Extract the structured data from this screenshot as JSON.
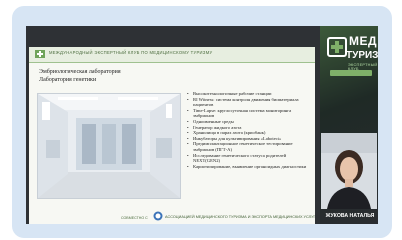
{
  "slide": {
    "header_title": "МЕЖДУНАРОДНЫЙ ЭКСПЕРТНЫЙ КЛУБ ПО МЕДИЦИНСКОМУ ТУРИЗМУ",
    "heading_line1": "Эмбриологическая лаборатория",
    "heading_line2": "Лаборатория генетики",
    "bullets": [
      "Высокотехнологичные рабочие станции",
      "RI Witness: система контроля движения биоматериала пациентов",
      "Time-Lapse: круглосуточная система мониторинга эмбрионов",
      "Одноименные среды",
      "Генератор жидкого азота",
      "Хранилища в парах азота (криобанк)",
      "Инкубаторы для культивирования «Labotect»",
      "Предимплантационное генетическое тестирование эмбрионов (ПГТ-А)",
      "Исследование генетического статуса родителей NEXT(GEN2)",
      "Кариотипирование, выявление органоидных диагностики"
    ],
    "footer_left": "СОВМЕСТНО С",
    "footer_right": "АССОЦИАЦИЕЙ МЕДИЦИНСКОГО ТУРИЗМА И ЭКСПОРТА МЕДИЦИНСКИХ УСЛУГ"
  },
  "brand": {
    "line1": "МЕД",
    "line2": "ТУРИЗМ",
    "line3": "ЭКСПЕРТНЫЙ КЛУБ"
  },
  "speaker": {
    "name": "ЖУКОВА НАТАЛЬЯ"
  },
  "colors": {
    "frame": "#d7e5f4",
    "accent_green": "#7fb069",
    "slide_bg": "#f7f8f3"
  }
}
